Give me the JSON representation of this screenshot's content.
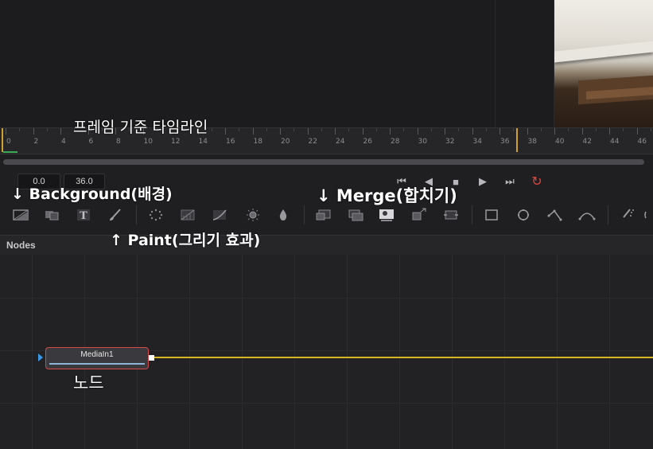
{
  "annotations": {
    "timeline": "프레임 기준 타임라인",
    "background": "↓ Background(배경)",
    "merge": "↓ Merge(합치기)",
    "paint": "↑ Paint(그리기 효과)",
    "node": "노드"
  },
  "ruler": {
    "labels": [
      "0",
      "2",
      "4",
      "6",
      "8",
      "10",
      "12",
      "14",
      "16",
      "18",
      "20",
      "22",
      "24",
      "26",
      "28",
      "30",
      "32",
      "34",
      "36",
      "38",
      "40",
      "42",
      "44",
      "46"
    ]
  },
  "time": {
    "start": "0.0",
    "end": "36.0"
  },
  "transport": {
    "buttons": [
      {
        "name": "go-to-start-icon",
        "glyph": "⏮"
      },
      {
        "name": "play-reverse-icon",
        "glyph": "◀"
      },
      {
        "name": "stop-icon",
        "glyph": "■"
      },
      {
        "name": "play-icon",
        "glyph": "▶"
      },
      {
        "name": "go-to-end-icon",
        "glyph": "⏭"
      },
      {
        "name": "loop-icon",
        "glyph": "↻"
      }
    ]
  },
  "nodes_panel": {
    "title": "Nodes"
  },
  "node": {
    "label": "MediaIn1"
  },
  "colors": {
    "accent_link": "#d6b422",
    "node_border": "#d24a4a",
    "loop": "#e0463c",
    "input_arrow": "#3c98e8"
  }
}
